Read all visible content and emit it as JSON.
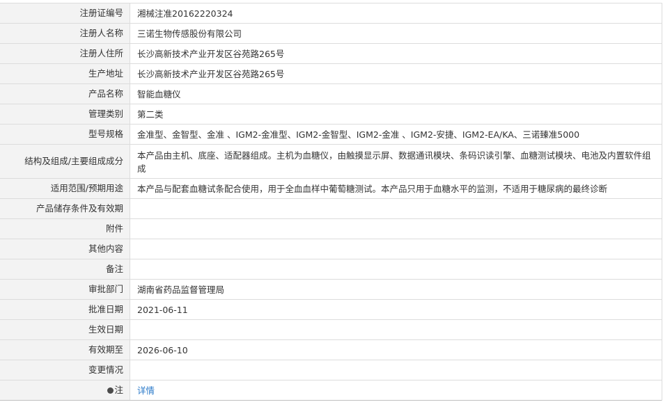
{
  "rows": [
    {
      "label": "注册证编号",
      "value": "湘械注准20162220324"
    },
    {
      "label": "注册人名称",
      "value": "三诺生物传感股份有限公司"
    },
    {
      "label": "注册人住所",
      "value": "长沙高新技术产业开发区谷苑路265号"
    },
    {
      "label": "生产地址",
      "value": "长沙高新技术产业开发区谷苑路265号"
    },
    {
      "label": "产品名称",
      "value": "智能血糖仪"
    },
    {
      "label": "管理类别",
      "value": "第二类"
    },
    {
      "label": "型号规格",
      "value": "金准型、金智型、金准 、IGM2-金准型、IGM2-金智型、IGM2-金准 、IGM2-安捷、IGM2-EA/KA、三诺臻准5000"
    },
    {
      "label": "结构及组成/主要组成成分",
      "value": "本产品由主机、底座、适配器组成。主机为血糖仪，由触摸显示屏、数据通讯模块、条码识读引擎、血糖测试模块、电池及内置软件组成"
    },
    {
      "label": "适用范围/预期用途",
      "value": "本产品与配套血糖试条配合使用，用于全血血样中葡萄糖测试。本产品只用于血糖水平的监测，不适用于糖尿病的最终诊断"
    },
    {
      "label": "产品储存条件及有效期",
      "value": ""
    },
    {
      "label": "附件",
      "value": ""
    },
    {
      "label": "其他内容",
      "value": ""
    },
    {
      "label": "备注",
      "value": ""
    },
    {
      "label": "审批部门",
      "value": "湖南省药品监督管理局"
    },
    {
      "label": "批准日期",
      "value": "2021-06-11"
    },
    {
      "label": "生效日期",
      "value": ""
    },
    {
      "label": "有效期至",
      "value": "2026-06-10"
    },
    {
      "label": "变更情况",
      "value": ""
    }
  ],
  "note_row": {
    "label": "注",
    "icon": "info-dot-icon",
    "link_text": "详情"
  }
}
